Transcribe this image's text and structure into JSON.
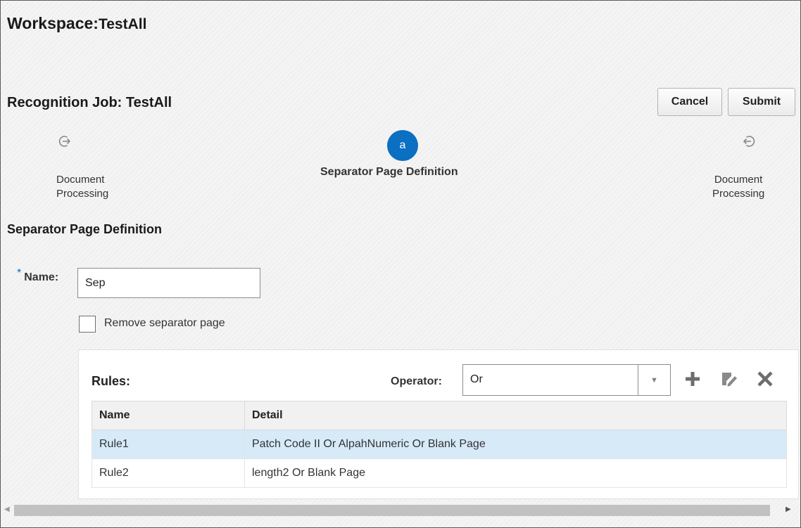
{
  "workspace": {
    "label": "Workspace:",
    "name": "TestAll"
  },
  "job": {
    "title": "Recognition Job: TestAll"
  },
  "actions": {
    "cancel": "Cancel",
    "submit": "Submit"
  },
  "train": {
    "previous": {
      "icon": "arrow-right-circle-icon",
      "line1": "Document",
      "line2": "Processing"
    },
    "current": {
      "marker": "a",
      "label": "Separator Page Definition"
    },
    "next": {
      "icon": "arrow-left-circle-icon",
      "line1": "Document",
      "line2": "Processing"
    }
  },
  "form": {
    "section_title": "Separator Page Definition",
    "required_marker": "*",
    "name_label": "Name:",
    "name_value": "Sep",
    "remove_separator_label": "Remove separator page",
    "remove_separator_checked": false
  },
  "rules": {
    "title": "Rules:",
    "operator_label": "Operator:",
    "operator_value": "Or",
    "toolbar_icons": [
      "add-icon",
      "edit-icon",
      "delete-icon"
    ],
    "columns": [
      "Name",
      "Detail"
    ],
    "rows": [
      {
        "name": "Rule1",
        "detail": "Patch Code II Or AlpahNumeric Or Blank Page",
        "selected": true
      },
      {
        "name": "Rule2",
        "detail": "length2 Or Blank Page",
        "selected": false
      }
    ]
  },
  "colors": {
    "accent": "#0b6fc2",
    "selected_row": "#d6eaf8",
    "header_bg": "#f1f1f1"
  }
}
